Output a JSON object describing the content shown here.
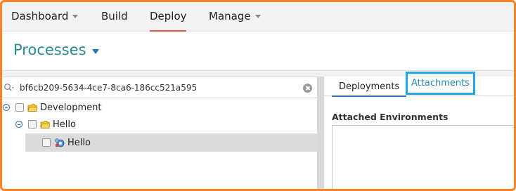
{
  "topnav": {
    "items": [
      {
        "label": "Dashboard",
        "dropdown": true
      },
      {
        "label": "Build",
        "dropdown": false
      },
      {
        "label": "Deploy",
        "dropdown": false,
        "active": true
      },
      {
        "label": "Manage",
        "dropdown": true
      }
    ]
  },
  "header": {
    "title": "Processes"
  },
  "search": {
    "value": "bf6cb209-5634-4ce7-8ca6-186cc521a595"
  },
  "tree": {
    "nodes": [
      {
        "label": "Development",
        "type": "folder-icon",
        "level": 0,
        "expanded": true
      },
      {
        "label": "Hello",
        "type": "folder-icon",
        "level": 1,
        "expanded": true
      },
      {
        "label": "Hello",
        "type": "process-icon",
        "level": 2,
        "selected": true
      }
    ]
  },
  "detail": {
    "tabs": [
      {
        "label": "Deployments",
        "active": true
      },
      {
        "label": "Attachments",
        "highlighted": true
      }
    ],
    "section_title": "Attached Environments"
  },
  "colors": {
    "accent": "#2e8c8c",
    "nav_active_underline": "#e2584e",
    "highlight_border": "#22a8e4",
    "frame": "#f5842a"
  }
}
